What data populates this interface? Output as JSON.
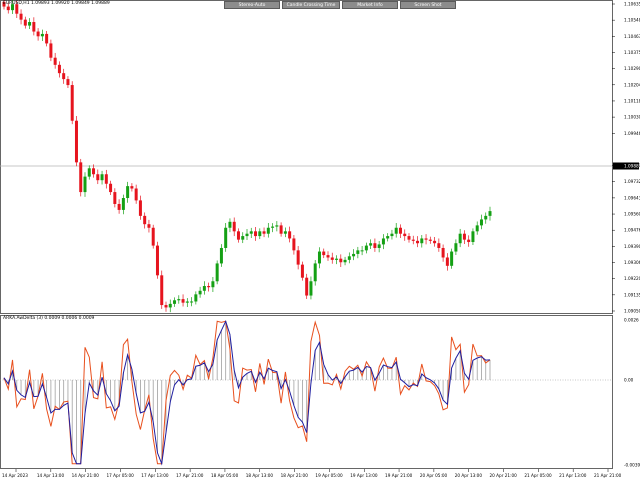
{
  "symbol_info": "EURUSD,H1  1.09893 1.09920 1.09849 1.09889",
  "indicator_info": "ARKA.AwDelta (3) 0.0009 0.0006 0.0009",
  "toolbar_buttons": [
    "Stereo-Auto",
    "Candle Crossing Time",
    "Market Info",
    "Screen Shot"
  ],
  "price_axis": [
    "1.10635",
    "1.10548",
    "1.10463",
    "1.10375",
    "1.10290",
    "1.10204",
    "1.10118",
    "1.10030",
    "1.09946",
    "1.09889",
    "1.09818",
    "1.09732",
    "1.09643",
    "1.09560",
    "1.09476",
    "1.09390",
    "1.09306",
    "1.09220",
    "1.09135",
    "1.09050"
  ],
  "current_price": "1.09889",
  "indicator_axis": [
    "0.0026",
    "0.00",
    "-0.0039"
  ],
  "time_axis": [
    "14 Apr 2023",
    "14 Apr 13:00",
    "14 Apr 21:00",
    "17 Apr 05:00",
    "17 Apr 13:00",
    "17 Apr 21:00",
    "18 Apr 05:00",
    "18 Apr 13:00",
    "18 Apr 21:00",
    "19 Apr 05:00",
    "19 Apr 13:00",
    "19 Apr 21:00",
    "20 Apr 05:00",
    "20 Apr 13:00",
    "20 Apr 21:00",
    "21 Apr 05:00",
    "21 Apr 13:00",
    "21 Apr 21:00"
  ],
  "colors": {
    "bull": "#14a014",
    "bear": "#e6141e",
    "osc_orange": "#e8501e",
    "osc_blue": "#1e1ea0",
    "histogram": "#a0a0a0",
    "price_line": "#b4b4b4"
  },
  "chart_data": {
    "type": "candlestick",
    "symbol": "EURUSD",
    "timeframe": "H1",
    "closes": [
      1.1061,
      1.1058,
      1.1063,
      1.1055,
      1.105,
      1.1045,
      1.1048,
      1.104,
      1.1036,
      1.1038,
      1.103,
      1.1018,
      1.1012,
      1.1005,
      1.1,
      1.0995,
      1.0965,
      1.093,
      1.0905,
      1.0918,
      1.0925,
      1.092,
      1.0915,
      1.092,
      1.0912,
      1.0905,
      1.0895,
      1.089,
      1.09,
      1.091,
      1.0908,
      1.0898,
      1.0885,
      1.0878,
      1.0875,
      1.086,
      1.0835,
      1.081,
      1.0808,
      1.0811,
      1.0814,
      1.0815,
      1.0812,
      1.0813,
      1.0813,
      1.0819,
      1.0822,
      1.0826,
      1.0825,
      1.083,
      1.0845,
      1.0858,
      1.0875,
      1.088,
      1.0872,
      1.0865,
      1.0868,
      1.087,
      1.0872,
      1.0868,
      1.0872,
      1.087,
      1.0875,
      1.0876,
      1.0877,
      1.087,
      1.0872,
      1.0866,
      1.0856,
      1.0844,
      1.0833,
      1.0818,
      1.083,
      1.0845,
      1.0855,
      1.0852,
      1.085,
      1.0848,
      1.0849,
      1.0846,
      1.0848,
      1.0851,
      1.0853,
      1.0856,
      1.0856,
      1.086,
      1.0862,
      1.0858,
      1.0861,
      1.0866,
      1.0868,
      1.087,
      1.0875,
      1.087,
      1.0868,
      1.0865,
      1.0864,
      1.0862,
      1.0866,
      1.0865,
      1.0864,
      1.0862,
      1.0858,
      1.085,
      1.0843,
      1.0855,
      1.0862,
      1.087,
      1.0865,
      1.0863,
      1.0872,
      1.0877,
      1.0882,
      1.0885,
      1.0889
    ]
  }
}
